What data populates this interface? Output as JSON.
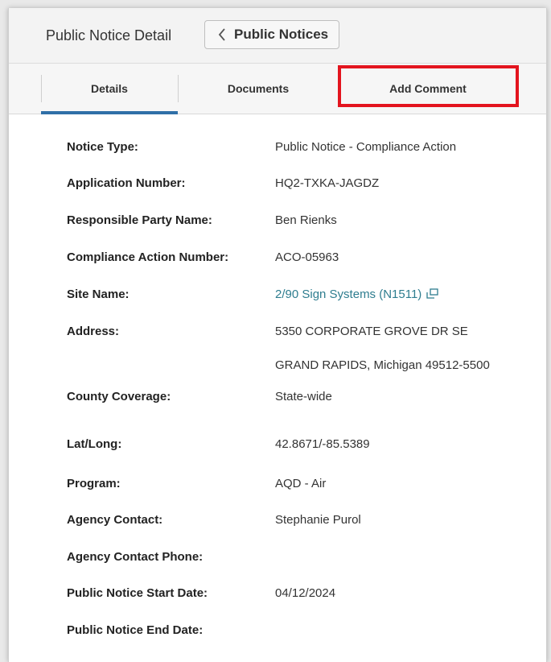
{
  "header": {
    "title": "Public Notice Detail",
    "back_button_label": "Public Notices"
  },
  "tabs": [
    {
      "label": "Details",
      "active": true
    },
    {
      "label": "Documents",
      "active": false
    },
    {
      "label": "Add Comment",
      "active": false,
      "highlighted": true
    }
  ],
  "fields": {
    "notice_type": {
      "label": "Notice Type:",
      "value": "Public Notice - Compliance Action"
    },
    "application_number": {
      "label": "Application Number:",
      "value": "HQ2-TXKA-JAGDZ"
    },
    "responsible_party": {
      "label": "Responsible Party Name:",
      "value": "Ben Rienks"
    },
    "compliance_action_number": {
      "label": "Compliance Action Number:",
      "value": "ACO-05963"
    },
    "site_name": {
      "label": "Site Name:",
      "value": "2/90 Sign Systems (N1511)"
    },
    "address": {
      "label": "Address:",
      "line1": "5350 CORPORATE GROVE DR SE",
      "line2": "GRAND RAPIDS, Michigan 49512-5500"
    },
    "county_coverage": {
      "label": "County Coverage:",
      "value": "State-wide"
    },
    "lat_long": {
      "label": "Lat/Long:",
      "value": "42.8671/-85.5389"
    },
    "program": {
      "label": "Program:",
      "value": "AQD - Air"
    },
    "agency_contact": {
      "label": "Agency Contact:",
      "value": "Stephanie Purol"
    },
    "agency_contact_phone": {
      "label": "Agency Contact Phone:",
      "value": ""
    },
    "start_date": {
      "label": "Public Notice Start Date:",
      "value": "04/12/2024"
    },
    "end_date": {
      "label": "Public Notice End Date:",
      "value": ""
    }
  },
  "colors": {
    "active_tab_underline": "#2f6fa7",
    "highlight_box": "#e3141e",
    "link": "#2e7d8f"
  },
  "icons": {
    "back": "chevron-left-icon",
    "site_link": "external-window-icon"
  }
}
